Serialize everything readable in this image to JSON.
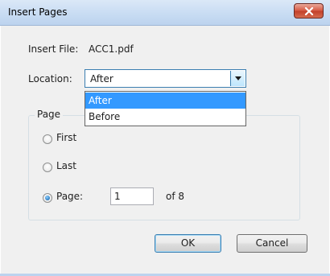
{
  "dialog": {
    "title": "Insert Pages",
    "insert_file_label": "Insert File:",
    "insert_file_value": "ACC1.pdf",
    "location_label": "Location:",
    "location_value": "After",
    "location_options": [
      "After",
      "Before"
    ],
    "page_group_title": "Page",
    "radio_first_label": "First",
    "radio_last_label": "Last",
    "radio_page_label": "Page:",
    "selected_radio": "Page:",
    "page_number_value": "1",
    "of_pages_label": "of 8",
    "ok_label": "OK",
    "cancel_label": "Cancel",
    "close_icon": "close-icon",
    "dropdown_arrow_icon": "chevron-down-icon",
    "accent_color": "#3399ff",
    "close_button_color": "#c2412b"
  }
}
